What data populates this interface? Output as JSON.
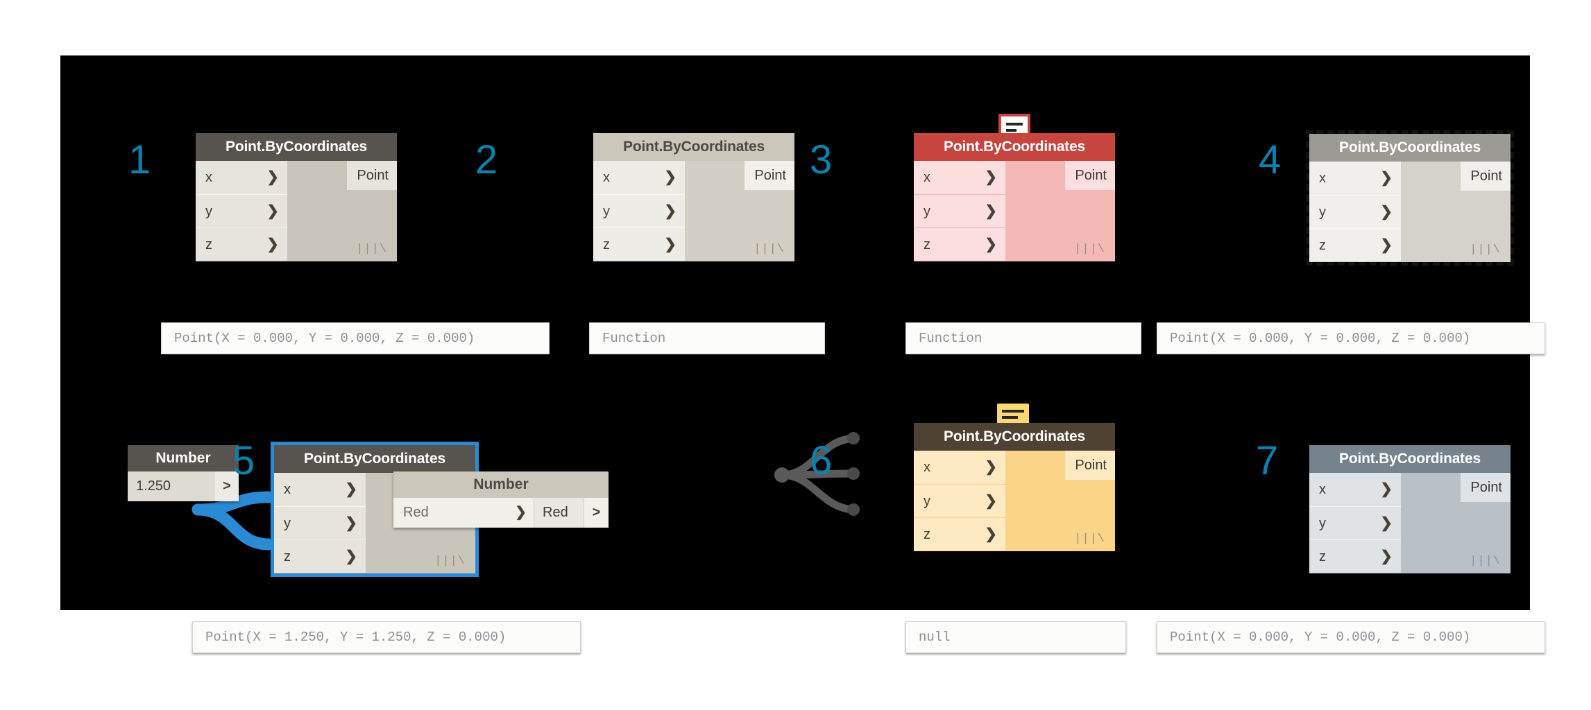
{
  "canvas": {
    "background": "#000000",
    "accent_number_color": "#0b82ad"
  },
  "node_title": "Point.ByCoordinates",
  "ports": {
    "inputs": [
      "x",
      "y",
      "z"
    ],
    "output": "Point",
    "caret_glyph": "❯",
    "lacing_glyph": "|||\\"
  },
  "nodes": [
    {
      "index": "1",
      "state": "normal",
      "title": "Point.ByCoordinates",
      "inputs": [
        "x",
        "y",
        "z"
      ],
      "output": "Point",
      "preview": "Point(X = 0.000, Y = 0.000, Z = 0.000)",
      "bubble": null
    },
    {
      "index": "2",
      "state": "frozen",
      "title": "Point.ByCoordinates",
      "inputs": [
        "x",
        "y",
        "z"
      ],
      "output": "Point",
      "preview": "Function",
      "bubble": null
    },
    {
      "index": "3",
      "state": "error",
      "title": "Point.ByCoordinates",
      "inputs": [
        "x",
        "y",
        "z"
      ],
      "output": "Point",
      "preview": "Function",
      "bubble": "error"
    },
    {
      "index": "4",
      "state": "dashed",
      "title": "Point.ByCoordinates",
      "inputs": [
        "x",
        "y",
        "z"
      ],
      "output": "Point",
      "preview": "Point(X = 0.000, Y = 0.000, Z = 0.000)",
      "bubble": null
    },
    {
      "index": "5",
      "state": "selected",
      "title": "Point.ByCoordinates",
      "inputs": [
        "x",
        "y",
        "z"
      ],
      "output": "Point",
      "preview": "Point(X = 1.250, Y = 1.250, Z = 0.000)",
      "bubble": null
    },
    {
      "index": "6",
      "state": "warning",
      "title": "Point.ByCoordinates",
      "inputs": [
        "x",
        "y",
        "z"
      ],
      "output": "Point",
      "preview": "null",
      "bubble": "warning"
    },
    {
      "index": "7",
      "state": "slate",
      "title": "Point.ByCoordinates",
      "inputs": [
        "x",
        "y",
        "z"
      ],
      "output": "Point",
      "preview": "Point(X = 0.000, Y = 0.000, Z = 0.000)",
      "bubble": null
    }
  ],
  "number_nodes": [
    {
      "id": "number-slider",
      "title": "Number",
      "value": "1.250",
      "port_glyph": ">"
    },
    {
      "id": "number-red",
      "title": "Number",
      "label": "Red",
      "value": "Red",
      "caret_glyph": "❯",
      "port_glyph": ">"
    }
  ]
}
